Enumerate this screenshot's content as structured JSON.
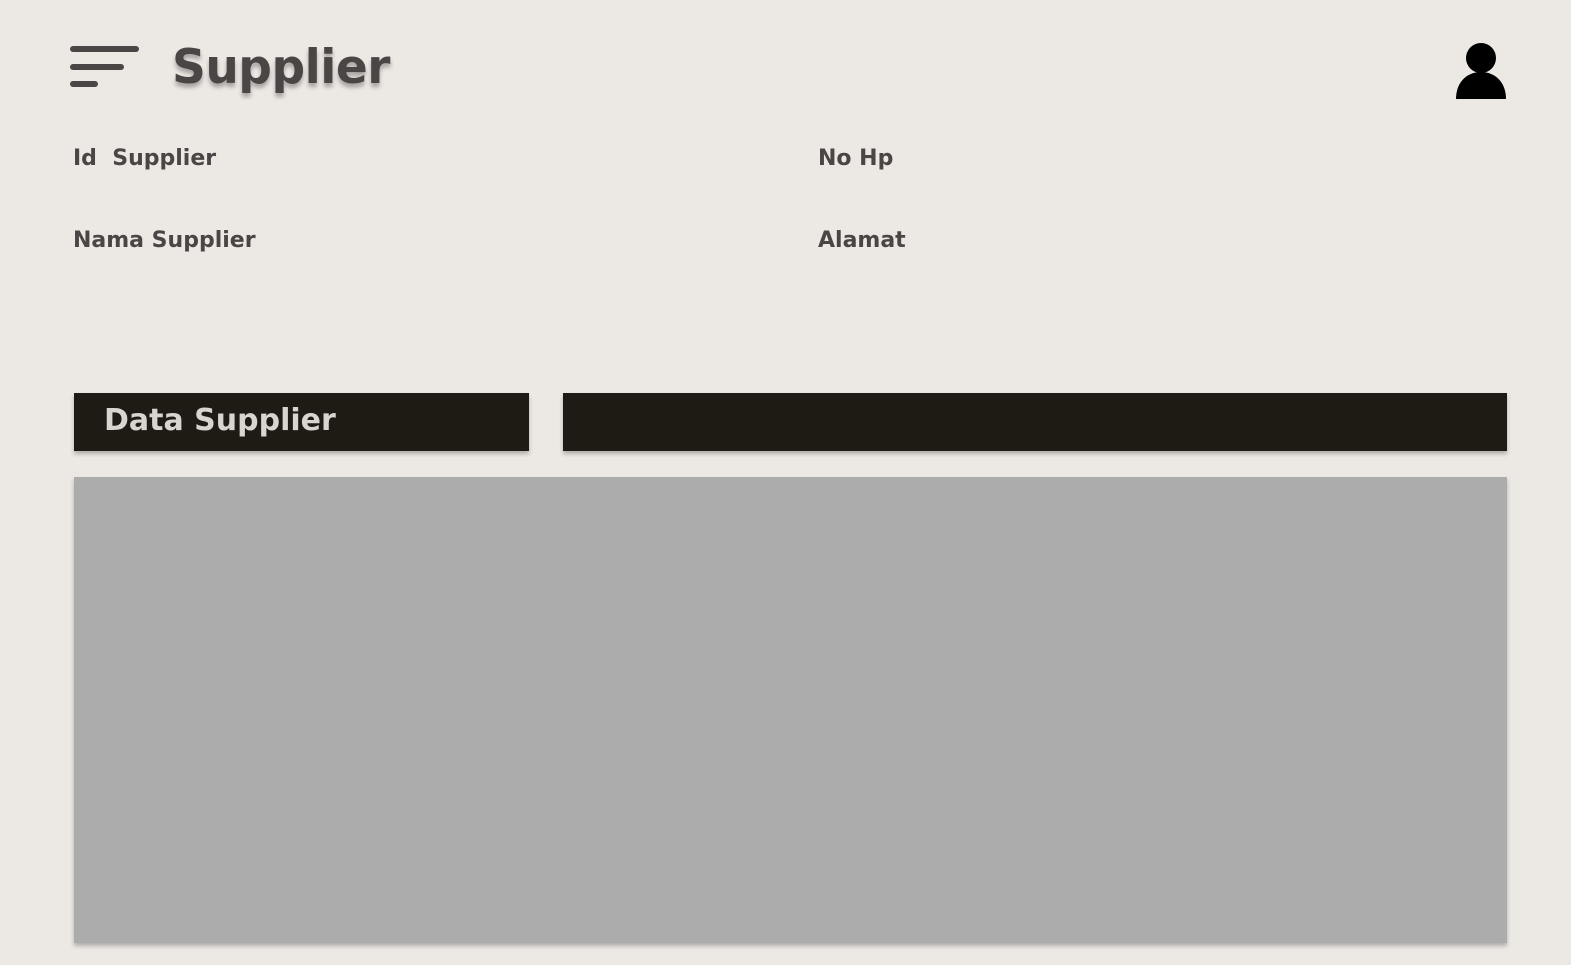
{
  "header": {
    "title": "Supplier",
    "menu_icon": "menu-icon",
    "user_icon": "user-icon"
  },
  "form": {
    "id_supplier_label": "Id  Supplier",
    "no_hp_label": "No Hp",
    "nama_supplier_label": "Nama Supplier",
    "alamat_label": "Alamat"
  },
  "data_section": {
    "header_label": "Data Supplier",
    "search_value": ""
  },
  "colors": {
    "background": "#ece8e4",
    "text": "#4a4646",
    "dark_bar": "#1e1a14",
    "header_text": "#d9d4cf",
    "table_area": "#acacac"
  }
}
